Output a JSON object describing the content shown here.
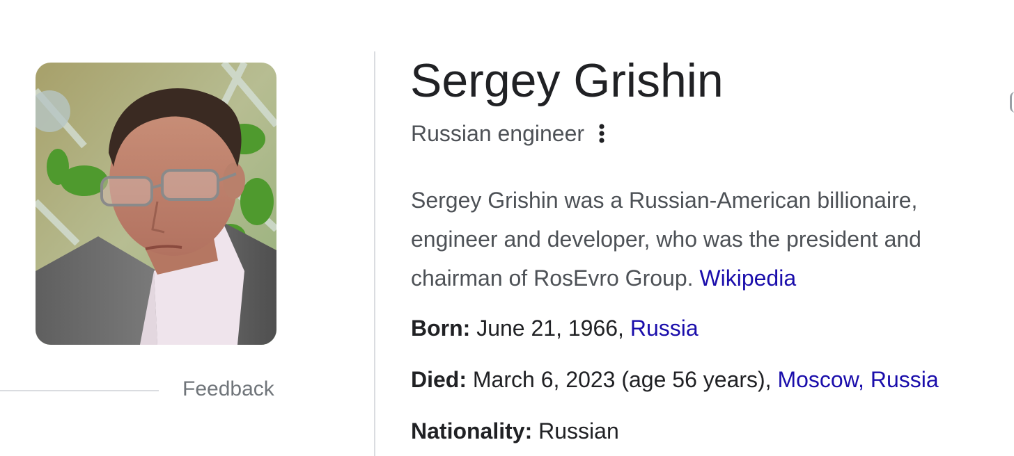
{
  "panel": {
    "title": "Sergey Grishin",
    "subtitle": "Russian engineer",
    "more_options_icon": "more-vert-icon",
    "description": {
      "line1": "Sergey Grishin was a Russian-American billionaire,",
      "line2": "engineer and developer, who was the president and",
      "line3_text": "chairman of RosEvro Group. ",
      "source_link": "Wikipedia"
    },
    "facts": {
      "born": {
        "label": "Born:",
        "value": " June 21, 1966, ",
        "link": "Russia"
      },
      "died": {
        "label": "Died:",
        "value": " March 6, 2023 (age 56 years), ",
        "link": "Moscow, Russia"
      },
      "nationality": {
        "label": "Nationality:",
        "value": " Russian"
      }
    }
  },
  "media": {
    "feedback_label": "Feedback"
  },
  "colors": {
    "title": "#202124",
    "secondary_text": "#4d5156",
    "link": "#1a0dab",
    "muted": "#70757a",
    "divider": "#dadce0"
  }
}
